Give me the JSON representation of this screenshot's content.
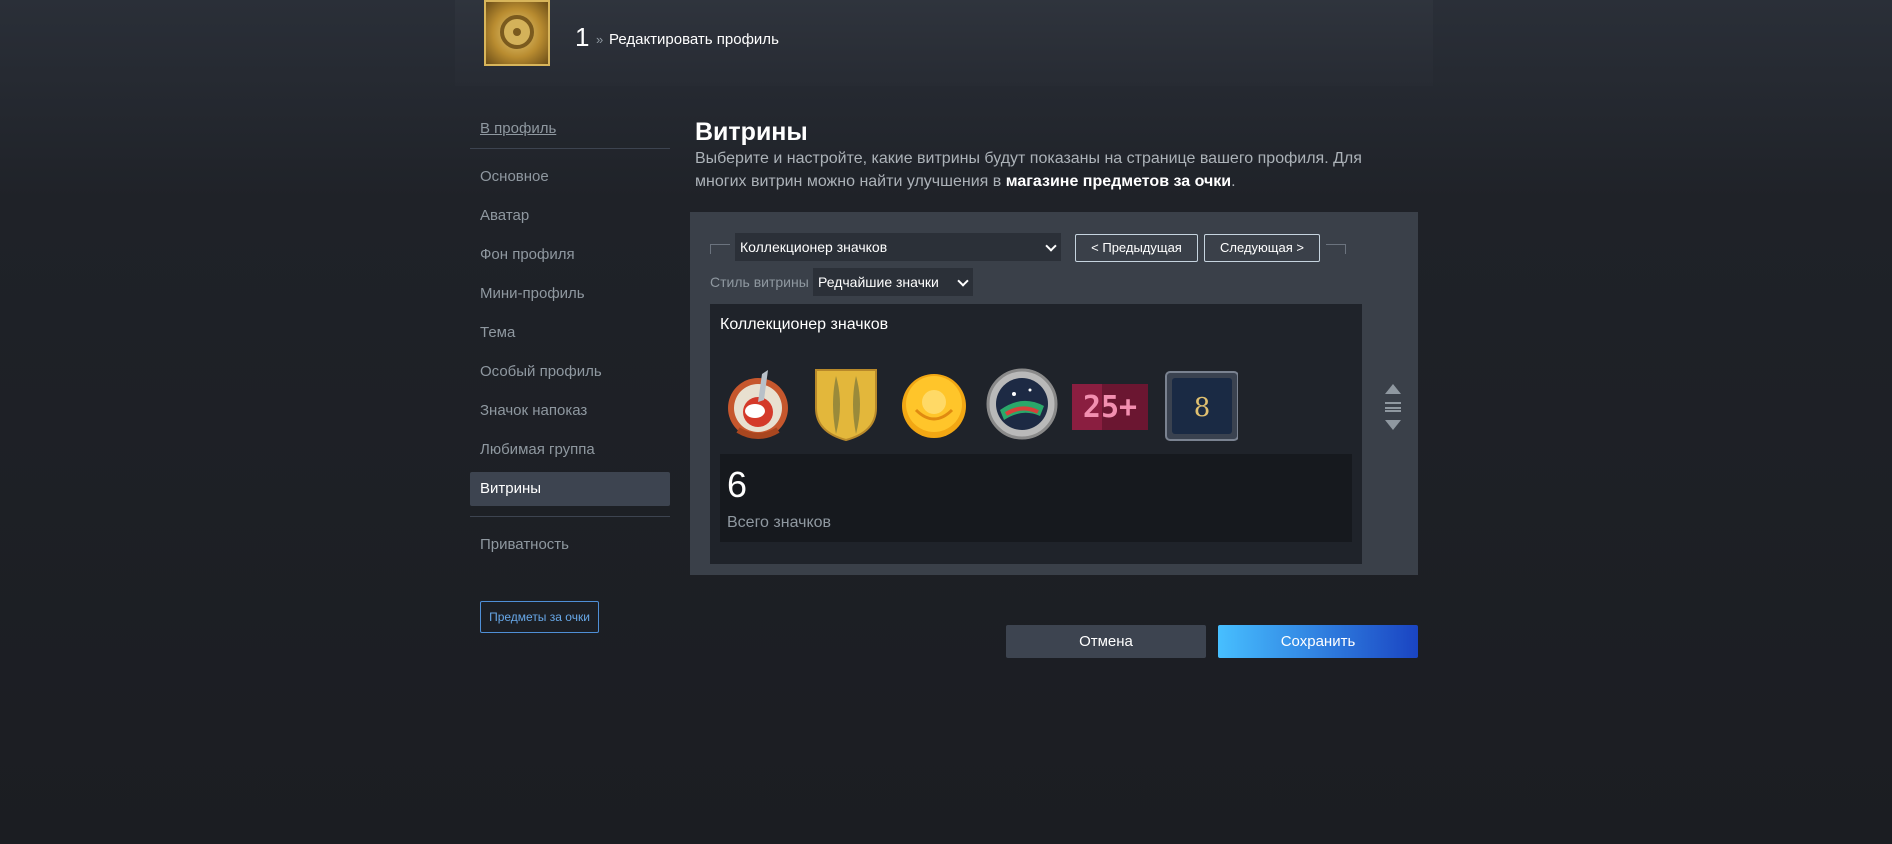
{
  "header": {
    "level": "1",
    "separator": "»",
    "title": "Редактировать профиль"
  },
  "sidebar": {
    "back_link": "В профиль",
    "items": [
      {
        "label": "Основное"
      },
      {
        "label": "Аватар"
      },
      {
        "label": "Фон профиля"
      },
      {
        "label": "Мини-профиль"
      },
      {
        "label": "Тема"
      },
      {
        "label": "Особый профиль"
      },
      {
        "label": "Значок напоказ"
      },
      {
        "label": "Любимая группа"
      },
      {
        "label": "Витрины",
        "active": true
      },
      {
        "label": "Приватность"
      }
    ],
    "points_button": "Предметы за очки"
  },
  "main": {
    "title": "Витрины",
    "description_before": "Выберите и настройте, какие витрины будут показаны на странице вашего профиля. Для многих витрин можно найти улучшения в ",
    "description_link": "магазине предметов за очки",
    "description_after": "."
  },
  "showcase": {
    "selected_showcase": "Коллекционер значков",
    "prev_button": "< Предыдущая",
    "next_button": "Следующая >",
    "style_label": "Стиль витрины",
    "selected_style": "Редчайшие значки",
    "panel_title": "Коллекционер значков",
    "badges": [
      {
        "icon": "rabbit-badge-icon"
      },
      {
        "icon": "laurel-shield-badge-icon"
      },
      {
        "icon": "gold-coin-badge-icon"
      },
      {
        "icon": "porthole-badge-icon"
      },
      {
        "icon": "years-badge-icon",
        "label": "25+"
      },
      {
        "icon": "number-badge-icon",
        "label": "8"
      }
    ],
    "stat_value": "6",
    "stat_label": "Всего значков"
  },
  "actions": {
    "cancel": "Отмена",
    "save": "Сохранить"
  }
}
